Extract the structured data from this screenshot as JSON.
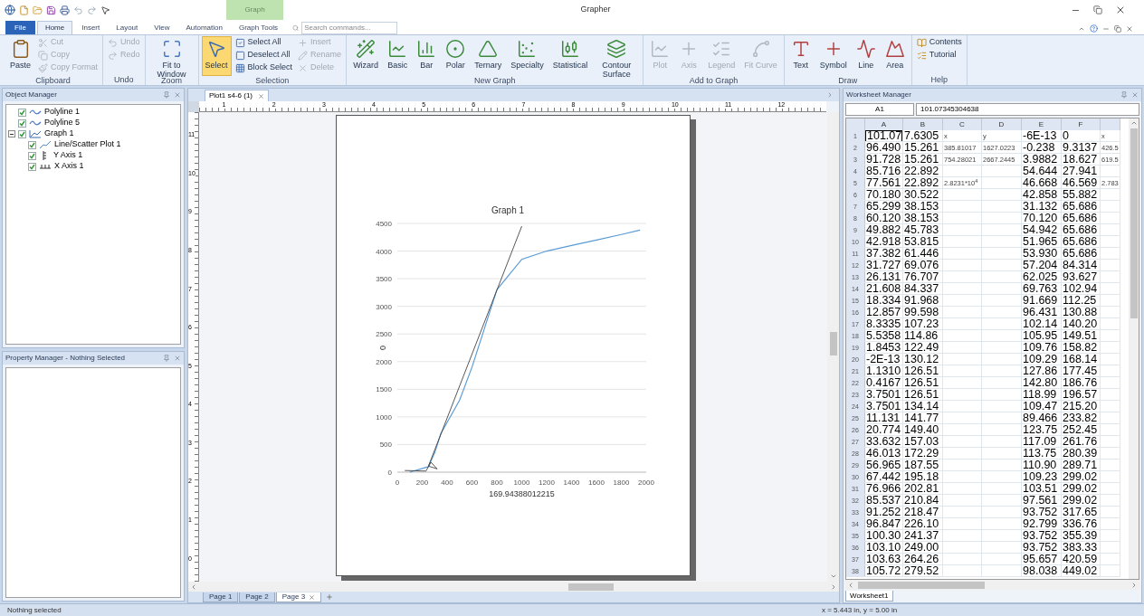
{
  "window": {
    "title": "Grapher",
    "context_tab_group": "Graph"
  },
  "ribbon_tabs": [
    {
      "label": "File",
      "selected": false,
      "kind": "file"
    },
    {
      "label": "Home",
      "selected": true,
      "kind": "tab"
    },
    {
      "label": "Insert",
      "selected": false,
      "kind": "tab"
    },
    {
      "label": "Layout",
      "selected": false,
      "kind": "tab"
    },
    {
      "label": "View",
      "selected": false,
      "kind": "tab"
    },
    {
      "label": "Automation",
      "selected": false,
      "kind": "tab"
    },
    {
      "label": "Graph Tools",
      "selected": false,
      "kind": "tab"
    }
  ],
  "search": {
    "placeholder": "Search commands..."
  },
  "ribbon_groups": [
    {
      "label": "Clipboard",
      "items": [
        {
          "label": "Paste",
          "kind": "large",
          "disabled": false
        },
        {
          "label": "Cut",
          "kind": "small",
          "disabled": true
        },
        {
          "label": "Copy",
          "kind": "small",
          "disabled": true
        },
        {
          "label": "Copy Format",
          "kind": "small",
          "disabled": true
        }
      ]
    },
    {
      "label": "Undo",
      "items": [
        {
          "label": "Undo",
          "kind": "small",
          "disabled": true
        },
        {
          "label": "Redo",
          "kind": "small",
          "disabled": true
        }
      ]
    },
    {
      "label": "Zoom",
      "items": [
        {
          "label": "Fit to Window",
          "kind": "large",
          "disabled": false
        }
      ]
    },
    {
      "label": "Selection",
      "items": [
        {
          "label": "Select",
          "kind": "large",
          "disabled": false,
          "selected": true
        },
        {
          "label": "Select All",
          "kind": "small",
          "disabled": false
        },
        {
          "label": "Deselect All",
          "kind": "small",
          "disabled": false
        },
        {
          "label": "Block Select",
          "kind": "small",
          "disabled": false
        },
        {
          "label": "Insert",
          "kind": "small",
          "disabled": true
        },
        {
          "label": "Rename",
          "kind": "small",
          "disabled": true
        },
        {
          "label": "Delete",
          "kind": "small",
          "disabled": true
        }
      ]
    },
    {
      "label": "New Graph",
      "items": [
        {
          "label": "Wizard",
          "kind": "large",
          "disabled": false
        },
        {
          "label": "Basic",
          "kind": "large",
          "disabled": false
        },
        {
          "label": "Bar",
          "kind": "large",
          "disabled": false
        },
        {
          "label": "Polar",
          "kind": "large",
          "disabled": false
        },
        {
          "label": "Ternary",
          "kind": "large",
          "disabled": false
        },
        {
          "label": "Specialty",
          "kind": "large",
          "disabled": false
        },
        {
          "label": "Statistical",
          "kind": "large",
          "disabled": false
        },
        {
          "label": "Contour Surface",
          "kind": "large",
          "disabled": false
        }
      ]
    },
    {
      "label": "Add to Graph",
      "items": [
        {
          "label": "Plot",
          "kind": "large",
          "disabled": true
        },
        {
          "label": "Axis",
          "kind": "large",
          "disabled": true
        },
        {
          "label": "Legend",
          "kind": "large",
          "disabled": true
        },
        {
          "label": "Fit Curve",
          "kind": "large",
          "disabled": true
        }
      ]
    },
    {
      "label": "Draw",
      "items": [
        {
          "label": "Text",
          "kind": "large",
          "disabled": false
        },
        {
          "label": "Symbol",
          "kind": "large",
          "disabled": false
        },
        {
          "label": "Line",
          "kind": "large",
          "disabled": false
        },
        {
          "label": "Area",
          "kind": "large",
          "disabled": false
        }
      ]
    },
    {
      "label": "Help",
      "items": [
        {
          "label": "Contents",
          "kind": "small",
          "disabled": false
        },
        {
          "label": "Tutorial",
          "kind": "small",
          "disabled": false
        }
      ]
    }
  ],
  "object_manager": {
    "title": "Object Manager",
    "items": [
      {
        "label": "Polyline 1",
        "checked": true,
        "kind": "polyline"
      },
      {
        "label": "Polyline 5",
        "checked": true,
        "kind": "polyline"
      },
      {
        "label": "Graph 1",
        "checked": true,
        "kind": "graph",
        "expanded": true,
        "children": [
          {
            "label": "Line/Scatter Plot 1",
            "checked": true,
            "kind": "plot"
          },
          {
            "label": "Y Axis 1",
            "checked": true,
            "kind": "yaxis"
          },
          {
            "label": "X Axis 1",
            "checked": true,
            "kind": "xaxis"
          }
        ]
      }
    ]
  },
  "property_manager": {
    "title": "Property Manager - Nothing Selected"
  },
  "document": {
    "tab": "Plot1 s4-6 (1)",
    "rulers": {
      "horizontal": [
        "1",
        "2",
        "3",
        "4",
        "5",
        "6",
        "7",
        "8",
        "9",
        "10",
        "11",
        "12"
      ],
      "vertical": [
        "11",
        "10",
        "9",
        "8",
        "7",
        "6",
        "5",
        "4",
        "3",
        "2",
        "1",
        "0"
      ]
    },
    "page_tabs": [
      {
        "label": "Page 1",
        "selected": false
      },
      {
        "label": "Page 2",
        "selected": false
      },
      {
        "label": "Page 3",
        "selected": true
      }
    ],
    "chart_data": {
      "type": "line",
      "title": "Graph 1",
      "xlabel": "169.94388012215",
      "ylabel": "0",
      "x": [
        100,
        250,
        300,
        350,
        400,
        500,
        600,
        700,
        800,
        1000,
        1200,
        1400,
        1600,
        1800,
        1950
      ],
      "grid": true,
      "series": [
        {
          "color": "#5b9bd5",
          "values": [
            0,
            100,
            350,
            700,
            900,
            1300,
            1900,
            2600,
            3300,
            3850,
            4000,
            4100,
            4200,
            4300,
            4380
          ]
        }
      ],
      "xlim": [
        0,
        2000
      ],
      "ylim": [
        0,
        4500
      ],
      "xticks": [
        0,
        200,
        400,
        600,
        800,
        1000,
        1200,
        1400,
        1600,
        1800,
        2000
      ],
      "yticks": [
        0,
        500,
        1000,
        1500,
        2000,
        2500,
        3000,
        3500,
        4000,
        4500
      ]
    }
  },
  "worksheet": {
    "title": "Worksheet Manager",
    "cell_ref": "A1",
    "cell_value": "101.07345304638",
    "columns": [
      "A",
      "B",
      "C",
      "D",
      "E",
      "F",
      null
    ],
    "rows": [
      {
        "n": "1",
        "cells": [
          "101.07",
          "7.6305",
          "x",
          "y",
          "-6E-13",
          "0",
          "x"
        ]
      },
      {
        "n": "2",
        "cells": [
          "96.490",
          "15.261",
          "385.81017",
          "1627.0223",
          "-0.238",
          "9.3137",
          "426.5"
        ]
      },
      {
        "n": "3",
        "cells": [
          "91.728",
          "15.261",
          "754.28021",
          "2667.2445",
          "3.9882",
          "18.627",
          "619.5"
        ]
      },
      {
        "n": "4",
        "cells": [
          "85.716",
          "22.892",
          null,
          null,
          "54.644",
          "27.941",
          null
        ]
      },
      {
        "n": "5",
        "cells": [
          "77.561",
          "22.892",
          "2.8231*10$^{4}$",
          null,
          "46.668",
          "46.569",
          "2.783"
        ]
      },
      {
        "n": "6",
        "cells": [
          "70.180",
          "30.522",
          null,
          null,
          "42.858",
          "55.882",
          null
        ]
      },
      {
        "n": "7",
        "cells": [
          "65.299",
          "38.153",
          null,
          null,
          "31.132",
          "65.686",
          null
        ]
      },
      {
        "n": "8",
        "cells": [
          "60.120",
          "38.153",
          null,
          null,
          "70.120",
          "65.686",
          null
        ]
      },
      {
        "n": "9",
        "cells": [
          "49.882",
          "45.783",
          null,
          null,
          "54.942",
          "65.686",
          null
        ]
      },
      {
        "n": "10",
        "cells": [
          "42.918",
          "53.815",
          null,
          null,
          "51.965",
          "65.686",
          null
        ]
      },
      {
        "n": "11",
        "cells": [
          "37.382",
          "61.446",
          null,
          null,
          "53.930",
          "65.686",
          null
        ]
      },
      {
        "n": "12",
        "cells": [
          "31.727",
          "69.076",
          null,
          null,
          "57.204",
          "84.314",
          null
        ]
      },
      {
        "n": "13",
        "cells": [
          "26.131",
          "76.707",
          null,
          null,
          "62.025",
          "93.627",
          null
        ]
      },
      {
        "n": "14",
        "cells": [
          "21.608",
          "84.337",
          null,
          null,
          "69.763",
          "102.94",
          null
        ]
      },
      {
        "n": "15",
        "cells": [
          "18.334",
          "91.968",
          null,
          null,
          "91.669",
          "112.25",
          null
        ]
      },
      {
        "n": "16",
        "cells": [
          "12.857",
          "99.598",
          null,
          null,
          "96.431",
          "130.88",
          null
        ]
      },
      {
        "n": "17",
        "cells": [
          "8.3335",
          "107.23",
          null,
          null,
          "102.14",
          "140.20",
          null
        ]
      },
      {
        "n": "18",
        "cells": [
          "5.5358",
          "114.86",
          null,
          null,
          "105.95",
          "149.51",
          null
        ]
      },
      {
        "n": "19",
        "cells": [
          "1.8453",
          "122.49",
          null,
          null,
          "109.76",
          "158.82",
          null
        ]
      },
      {
        "n": "20",
        "cells": [
          "-2E-13",
          "130.12",
          null,
          null,
          "109.29",
          "168.14",
          null
        ]
      },
      {
        "n": "21",
        "cells": [
          "1.1310",
          "126.51",
          null,
          null,
          "127.86",
          "177.45",
          null
        ]
      },
      {
        "n": "22",
        "cells": [
          "0.4167",
          "126.51",
          null,
          null,
          "142.80",
          "186.76",
          null
        ]
      },
      {
        "n": "23",
        "cells": [
          "3.7501",
          "126.51",
          null,
          null,
          "118.99",
          "196.57",
          null
        ]
      },
      {
        "n": "24",
        "cells": [
          "3.7501",
          "134.14",
          null,
          null,
          "109.47",
          "215.20",
          null
        ]
      },
      {
        "n": "25",
        "cells": [
          "11.131",
          "141.77",
          null,
          null,
          "89.466",
          "233.82",
          null
        ]
      },
      {
        "n": "26",
        "cells": [
          "20.774",
          "149.40",
          null,
          null,
          "123.75",
          "252.45",
          null
        ]
      },
      {
        "n": "27",
        "cells": [
          "33.632",
          "157.03",
          null,
          null,
          "117.09",
          "261.76",
          null
        ]
      },
      {
        "n": "28",
        "cells": [
          "46.013",
          "172.29",
          null,
          null,
          "113.75",
          "280.39",
          null
        ]
      },
      {
        "n": "29",
        "cells": [
          "56.965",
          "187.55",
          null,
          null,
          "110.90",
          "289.71",
          null
        ]
      },
      {
        "n": "30",
        "cells": [
          "67.442",
          "195.18",
          null,
          null,
          "109.23",
          "299.02",
          null
        ]
      },
      {
        "n": "31",
        "cells": [
          "76.966",
          "202.81",
          null,
          null,
          "103.51",
          "299.02",
          null
        ]
      },
      {
        "n": "32",
        "cells": [
          "85.537",
          "210.84",
          null,
          null,
          "97.561",
          "299.02",
          null
        ]
      },
      {
        "n": "33",
        "cells": [
          "91.252",
          "218.47",
          null,
          null,
          "93.752",
          "317.65",
          null
        ]
      },
      {
        "n": "34",
        "cells": [
          "96.847",
          "226.10",
          null,
          null,
          "92.799",
          "336.76",
          null
        ]
      },
      {
        "n": "35",
        "cells": [
          "100.30",
          "241.37",
          null,
          null,
          "93.752",
          "355.39",
          null
        ]
      },
      {
        "n": "36",
        "cells": [
          "103.10",
          "249.00",
          null,
          null,
          "93.752",
          "383.33",
          null
        ]
      },
      {
        "n": "37",
        "cells": [
          "103.63",
          "264.26",
          null,
          null,
          "95.657",
          "420.59",
          null
        ]
      },
      {
        "n": "38",
        "cells": [
          "105.72",
          "279.52",
          null,
          null,
          "98.038",
          "449.02",
          null
        ]
      }
    ],
    "sheet_tabs": [
      {
        "label": "Worksheet1",
        "selected": true
      }
    ]
  },
  "status_bar": {
    "left": "Nothing selected",
    "right": "x = 5.443 in, y = 5.00 in"
  }
}
